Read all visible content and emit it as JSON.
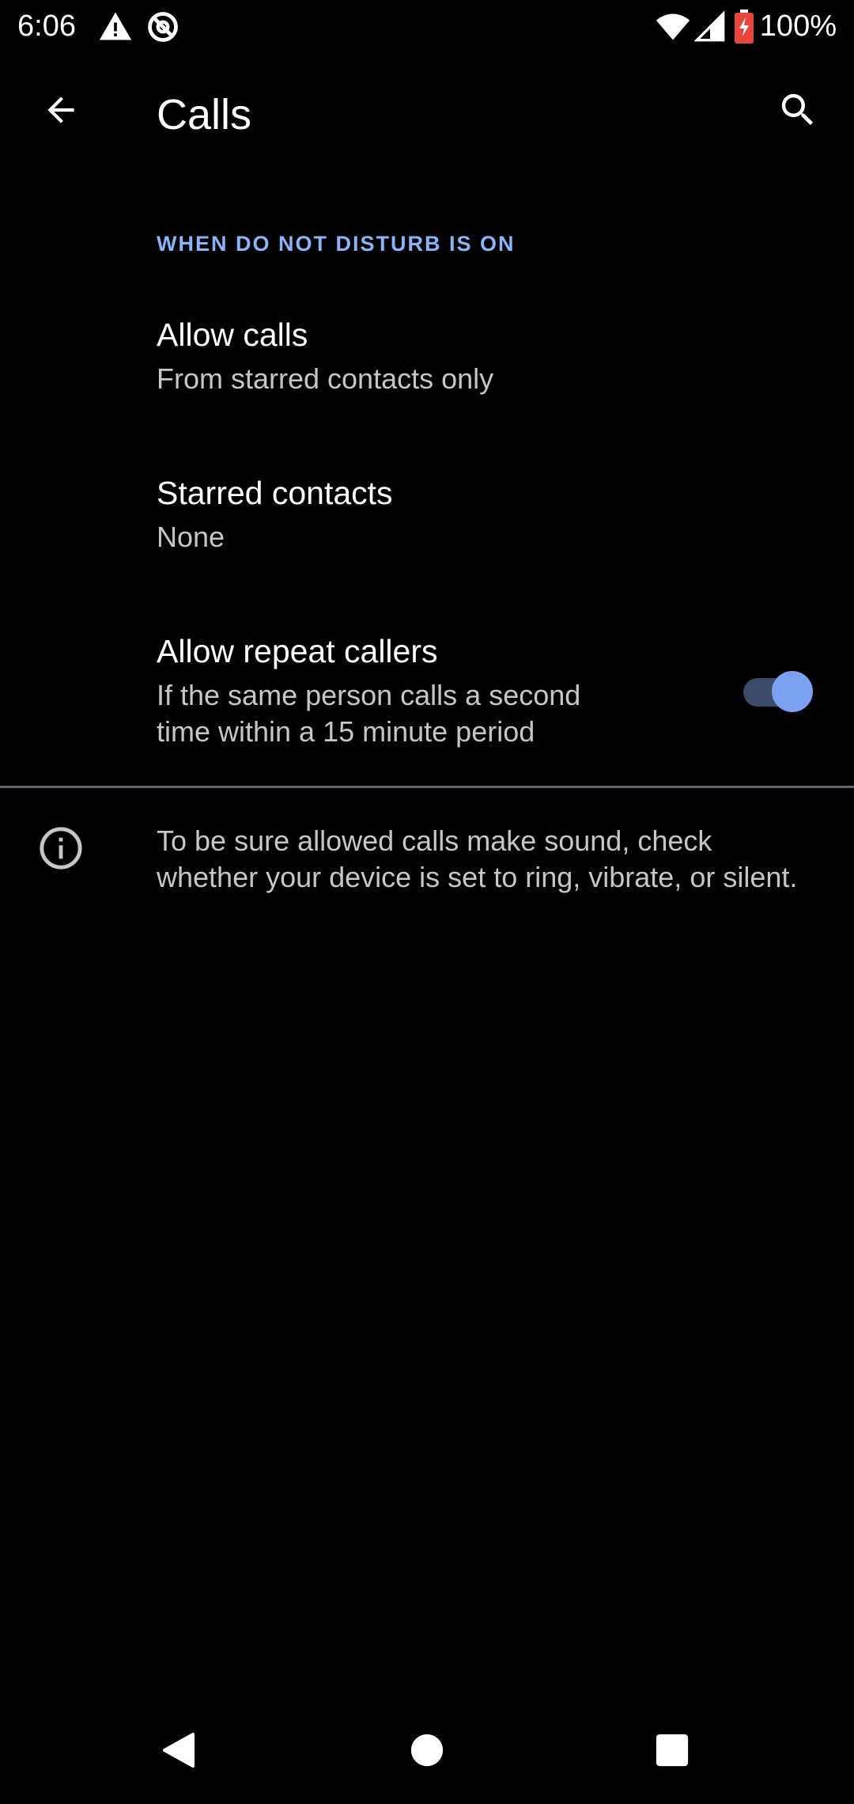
{
  "status_bar": {
    "time": "6:06",
    "battery_percent": "100%",
    "icons": [
      "alert-icon",
      "data-saver-icon",
      "wifi-icon",
      "cell-signal-icon",
      "battery-charging-icon"
    ]
  },
  "app_bar": {
    "title": "Calls",
    "back_icon": "arrow-back-icon",
    "search_icon": "search-icon"
  },
  "section": {
    "header": "WHEN DO NOT DISTURB IS ON"
  },
  "preferences": [
    {
      "title": "Allow calls",
      "summary": "From starred contacts only"
    },
    {
      "title": "Starred contacts",
      "summary": "None"
    },
    {
      "title": "Allow repeat callers",
      "summary_line1": "If the same person calls a second",
      "summary_line2": "time within a 15 minute period",
      "toggle_on": true
    }
  ],
  "footer": {
    "info_icon": "info-icon",
    "text": "To be sure allowed calls make sound, check whether your device is set to ring, vibrate, or silent."
  },
  "nav_bar": {
    "icons": [
      "nav-back-icon",
      "nav-home-icon",
      "nav-recents-icon"
    ]
  },
  "colors": {
    "background": "#000000",
    "accent": "#8ab4f8",
    "toggle_thumb": "#7aa2f0",
    "toggle_track": "#3b4a68",
    "summary_text": "#c4c7c5",
    "divider": "#5f6368"
  }
}
